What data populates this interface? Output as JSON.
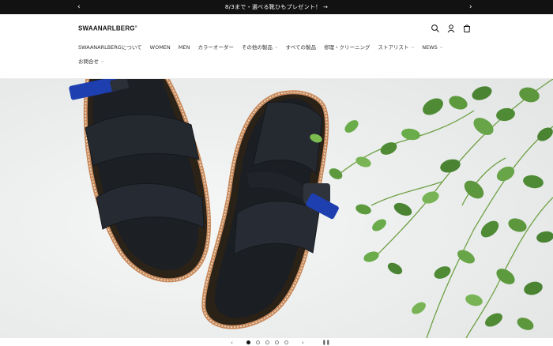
{
  "announcement": {
    "text": "8/3まで・選べる靴ひもプレゼント！ →",
    "prev_icon": "chevron-left-icon",
    "next_icon": "chevron-right-icon"
  },
  "brand": {
    "name": "SWAANARLBERG",
    "mark": "®"
  },
  "header_icons": [
    "search-icon",
    "account-icon",
    "cart-icon"
  ],
  "nav": {
    "items": [
      {
        "label": "SWAANARLBERGについて",
        "has_dropdown": false
      },
      {
        "label": "WOMEN",
        "has_dropdown": false
      },
      {
        "label": "MEN",
        "has_dropdown": false
      },
      {
        "label": "カラーオーダー",
        "has_dropdown": false
      },
      {
        "label": "その他の製品",
        "has_dropdown": true
      },
      {
        "label": "すべての製品",
        "has_dropdown": false
      },
      {
        "label": "修理・クリーニング",
        "has_dropdown": false
      },
      {
        "label": "ストアリスト",
        "has_dropdown": true
      },
      {
        "label": "NEWS",
        "has_dropdown": true
      },
      {
        "label": "お問合せ",
        "has_dropdown": true
      }
    ]
  },
  "slider": {
    "slide_count": 5,
    "active_index": 0,
    "prev_icon": "chevron-left-icon",
    "next_icon": "chevron-right-icon",
    "pause_icon": "pause-icon"
  },
  "colors": {
    "announcement_bg": "#121212",
    "strap_blue": "#1d3fb0",
    "sandal_black": "#1f2328",
    "leaf_green": "#5a9a3a"
  }
}
